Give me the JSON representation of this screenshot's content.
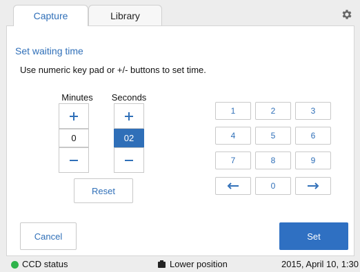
{
  "tabs": [
    {
      "label": "Capture",
      "active": true
    },
    {
      "label": "Library",
      "active": false
    }
  ],
  "settings_icon": "gear-icon",
  "panel": {
    "title": "Set waiting time",
    "instruction": "Use numeric key pad or +/- buttons to set time.",
    "minutes": {
      "label": "Minutes",
      "value": "0",
      "increment": "+",
      "decrement": "−"
    },
    "seconds": {
      "label": "Seconds",
      "value": "02",
      "increment": "+",
      "decrement": "−",
      "selected": true
    },
    "reset_label": "Reset",
    "keypad": [
      "1",
      "2",
      "3",
      "4",
      "5",
      "6",
      "7",
      "8",
      "9",
      "←",
      "0",
      "→"
    ]
  },
  "actions": {
    "cancel": "Cancel",
    "set": "Set"
  },
  "status": {
    "ccd": "CCD status",
    "ccd_color": "#2fb34b",
    "position": "Lower position",
    "position_icon": "camera-icon",
    "datetime": "2015, April 10, 1:30"
  },
  "colors": {
    "accent": "#2f6fb8",
    "primary_button": "#2f70c2"
  }
}
